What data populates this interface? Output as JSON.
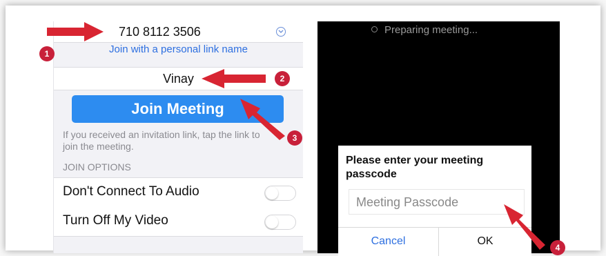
{
  "join_form": {
    "meeting_id": "710 8112 3506",
    "dropdown_icon": "chevron-down-icon",
    "personal_link_label": "Join with a personal link name",
    "name_value": "Vinay",
    "join_button_label": "Join Meeting",
    "hint_text": "If you received an invitation link, tap the link to join the meeting.",
    "join_options_header": "JOIN OPTIONS",
    "options": [
      {
        "label": "Don't Connect To Audio",
        "enabled": false
      },
      {
        "label": "Turn Off My Video",
        "enabled": false
      }
    ]
  },
  "meeting_screen": {
    "status_text": "Preparing meeting...",
    "dialog": {
      "title": "Please enter your meeting passcode",
      "passcode_placeholder": "Meeting Passcode",
      "cancel_label": "Cancel",
      "ok_label": "OK"
    }
  },
  "callouts": [
    "1",
    "2",
    "3",
    "4"
  ],
  "colors": {
    "accent_blue": "#2d8cf0",
    "link_blue": "#2d6fe0",
    "callout_red": "#c8203a",
    "arrow_red": "#d82532"
  }
}
